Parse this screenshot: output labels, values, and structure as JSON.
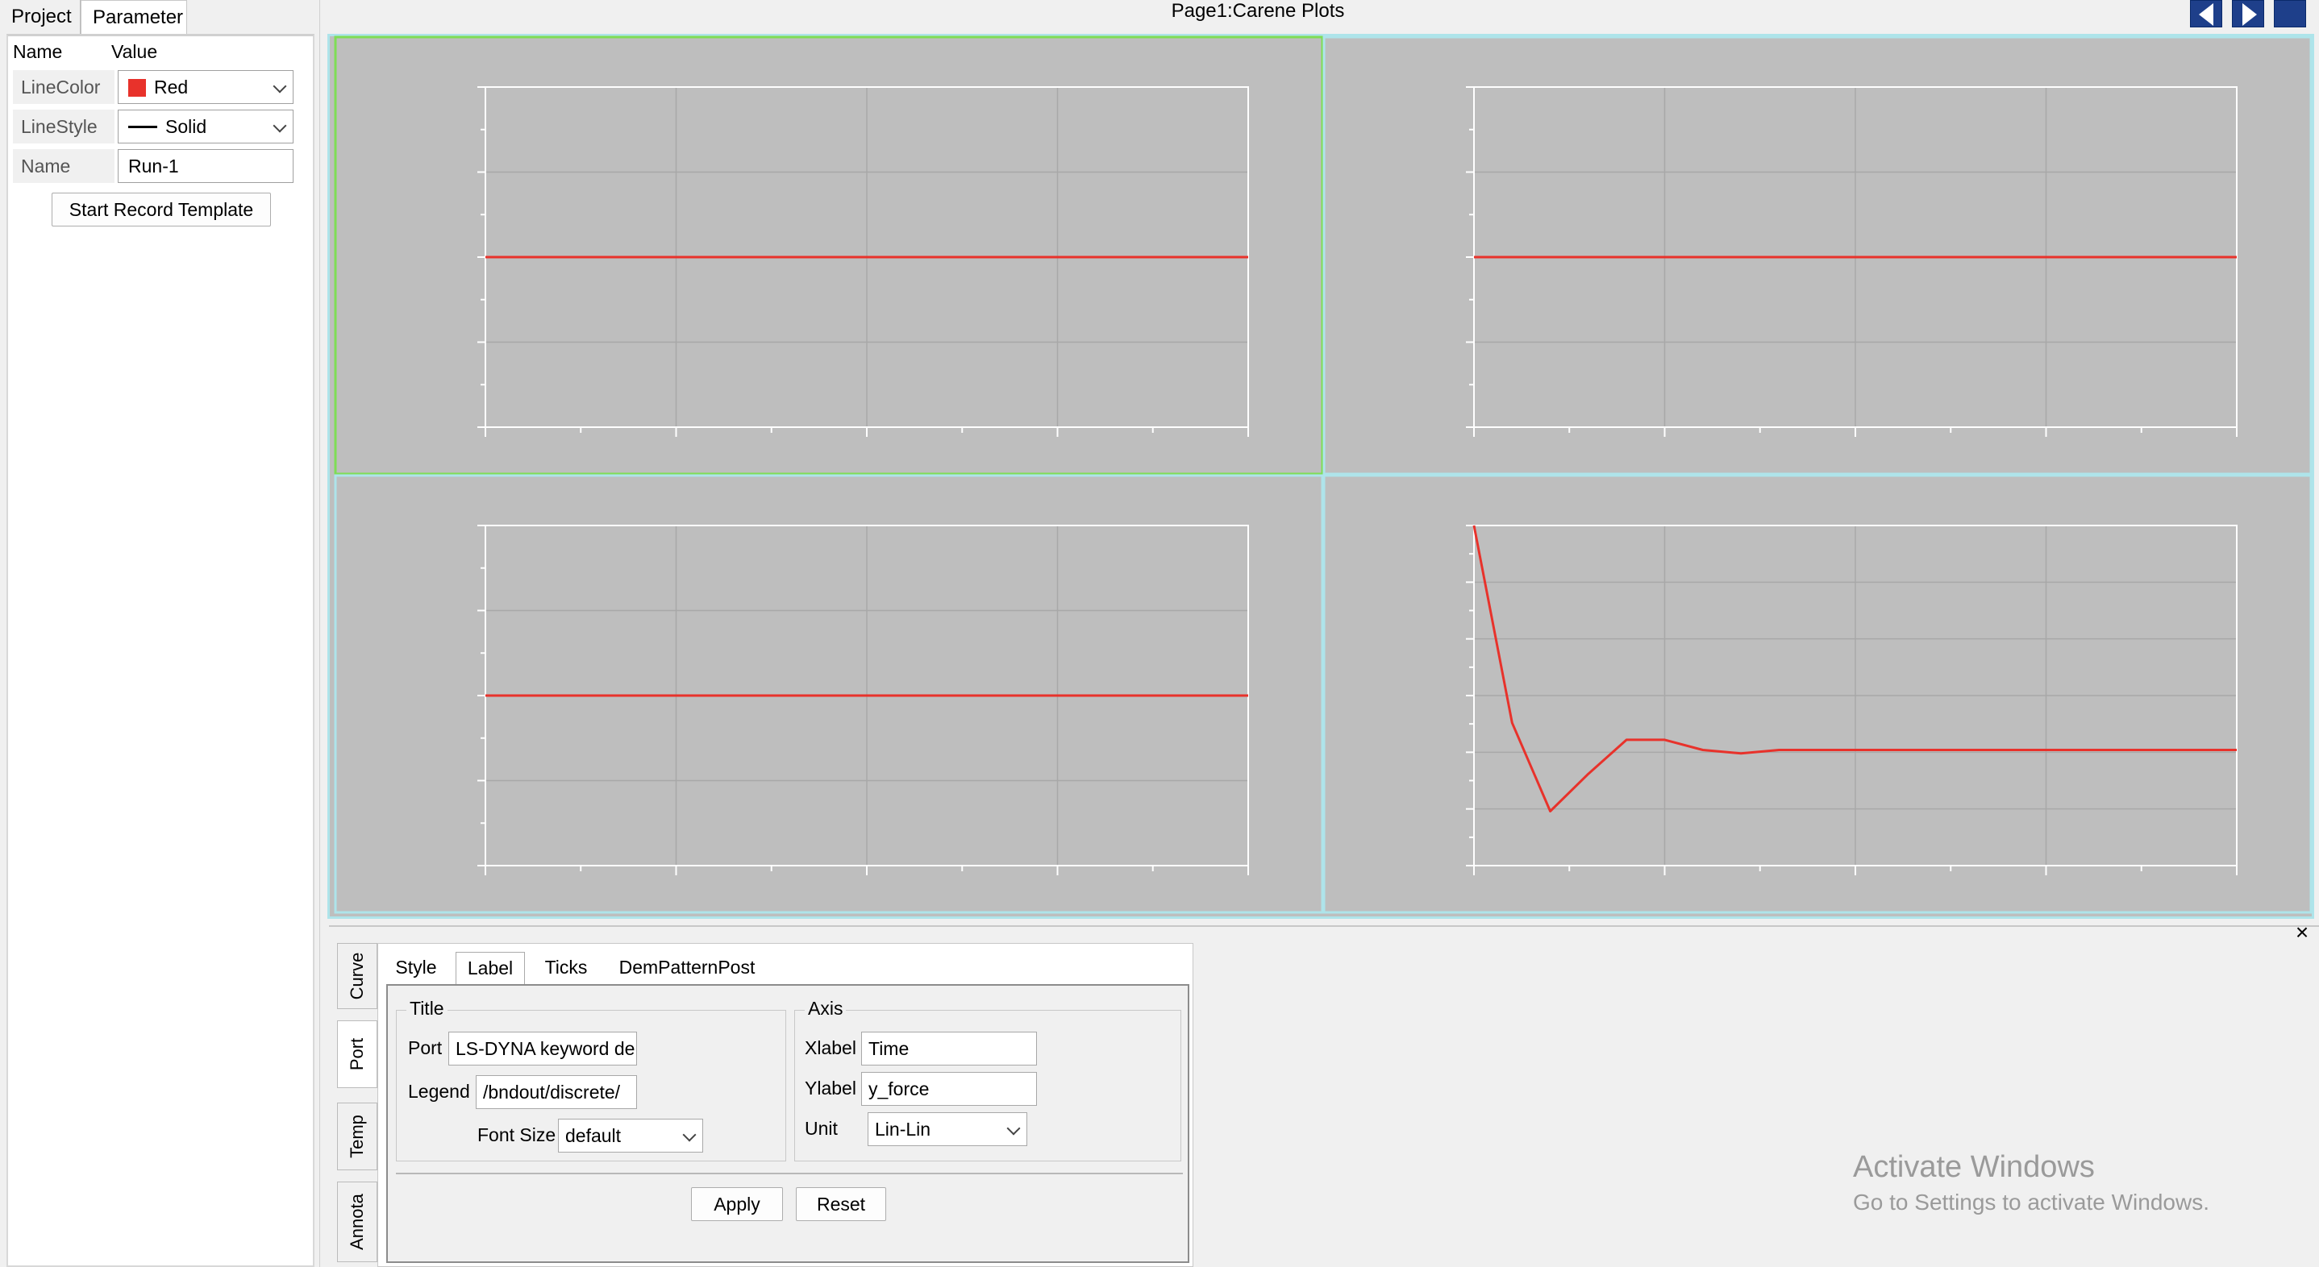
{
  "left_panel": {
    "tabs": [
      "Project",
      "Parameter"
    ],
    "header": {
      "name": "Name",
      "value": "Value"
    },
    "rows": [
      {
        "name": "LineColor",
        "value": "Red",
        "swatch": "#e8322b"
      },
      {
        "name": "LineStyle",
        "value": "Solid"
      },
      {
        "name": "Name",
        "value": "Run-1"
      }
    ],
    "record_button": "Start Record Template"
  },
  "page": {
    "title": "Page1:Carene Plots",
    "nav": {
      "prev_icon": "triangle-left-icon",
      "next_icon": "triangle-right-icon",
      "stop_icon": "square-stop-icon"
    }
  },
  "colors": {
    "plot_bg": "#bebebe",
    "grid": "#a8a8a8",
    "axis": "#ffffff",
    "curve": "#e8322b",
    "active_border": "#7fdd55",
    "frame_border": "#aee4ea"
  },
  "chart_data": [
    {
      "type": "line",
      "x": [
        0,
        1,
        2,
        3,
        4
      ],
      "y": [
        0.5,
        0.5,
        0.5,
        0.5,
        0.5
      ],
      "xlim": [
        0,
        4
      ],
      "ylim": [
        0,
        1
      ],
      "grid": true,
      "selected": true
    },
    {
      "type": "line",
      "x": [
        0,
        1,
        2,
        3,
        4
      ],
      "y": [
        0.5,
        0.5,
        0.5,
        0.5,
        0.5
      ],
      "xlim": [
        0,
        4
      ],
      "ylim": [
        0,
        1
      ],
      "grid": true
    },
    {
      "type": "line",
      "x": [
        0,
        1,
        2,
        3,
        4
      ],
      "y": [
        0.5,
        0.5,
        0.5,
        0.5,
        0.5
      ],
      "xlim": [
        0,
        4
      ],
      "ylim": [
        0,
        1
      ],
      "grid": true
    },
    {
      "type": "line",
      "x": [
        0,
        0.2,
        0.4,
        0.6,
        0.8,
        1.0,
        1.2,
        1.4,
        1.6,
        1.8,
        2.0,
        2.5,
        3.0,
        3.5,
        4.0
      ],
      "y": [
        1.0,
        0.42,
        0.16,
        0.27,
        0.37,
        0.37,
        0.34,
        0.33,
        0.34,
        0.34,
        0.34,
        0.34,
        0.34,
        0.34,
        0.34
      ],
      "xlim": [
        0,
        4
      ],
      "ylim": [
        0,
        1
      ],
      "grid": true
    }
  ],
  "dock": {
    "close_label": "×",
    "side_tabs": [
      "Curve",
      "Port",
      "Temp",
      "Annota"
    ],
    "tabs": [
      "Style",
      "Label",
      "Ticks",
      "DemPatternPost"
    ],
    "title_group": {
      "label": "Title",
      "port_label": "Port",
      "port_value": "LS-DYNA keyword de",
      "legend_label": "Legend",
      "legend_value": "/bndout/discrete/",
      "font_size_label": "Font Size",
      "font_size_value": "default"
    },
    "axis_group": {
      "label": "Axis",
      "xlabel_label": "Xlabel",
      "xlabel_value": "Time",
      "ylabel_label": "Ylabel",
      "ylabel_value": "y_force",
      "unit_label": "Unit",
      "unit_value": "Lin-Lin"
    },
    "apply": "Apply",
    "reset": "Reset"
  },
  "watermark": {
    "line1": "Activate Windows",
    "line2": "Go to Settings to activate Windows."
  }
}
